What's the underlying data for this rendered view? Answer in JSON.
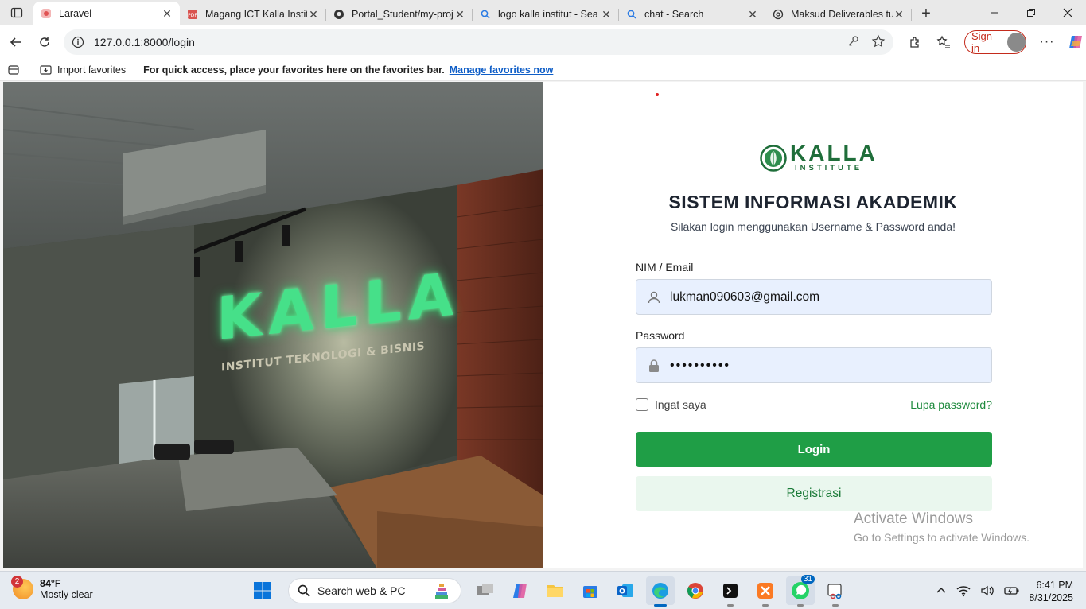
{
  "browser": {
    "tabs": [
      {
        "title": "Laravel",
        "active": true
      },
      {
        "title": "Magang ICT Kalla Instit",
        "active": false
      },
      {
        "title": "Portal_Student/my-proj",
        "active": false
      },
      {
        "title": "logo kalla institut - Sea",
        "active": false
      },
      {
        "title": "chat - Search",
        "active": false
      },
      {
        "title": "Maksud Deliverables tu",
        "active": false
      }
    ],
    "url": "127.0.0.1:8000/login",
    "signin_label": "Sign in",
    "favorites_bar": {
      "import_label": "Import favorites",
      "message": "For quick access, place your favorites here on the favorites bar.",
      "manage_link": "Manage favorites now"
    }
  },
  "photo": {
    "sign_main": "KALLA",
    "sign_sub": "INSTITUT TEKNOLOGI & BISNIS"
  },
  "login": {
    "logo_main": "KALLA",
    "logo_sub": "INSTITUTE",
    "title": "SISTEM INFORMASI AKADEMIK",
    "subtitle": "Silakan login menggunakan Username & Password anda!",
    "username_label": "NIM / Email",
    "username_value": "lukman090603@gmail.com",
    "password_label": "Password",
    "password_value": "••••••••••",
    "remember_label": "Ingat saya",
    "forgot_label": "Lupa password?",
    "login_button": "Login",
    "register_button": "Registrasi"
  },
  "watermark": {
    "line1": "Activate Windows",
    "line2": "Go to Settings to activate Windows."
  },
  "taskbar": {
    "weather_badge": "2",
    "temperature": "84°F",
    "condition": "Mostly clear",
    "search_placeholder": "Search web & PC",
    "whatsapp_badge": "31",
    "time": "6:41 PM",
    "date": "8/31/2025"
  },
  "colors": {
    "primary_green": "#1f9e46",
    "register_bg": "#eaf7ee",
    "link_green": "#1e8a3d",
    "field_bg": "#e8f0fe"
  }
}
